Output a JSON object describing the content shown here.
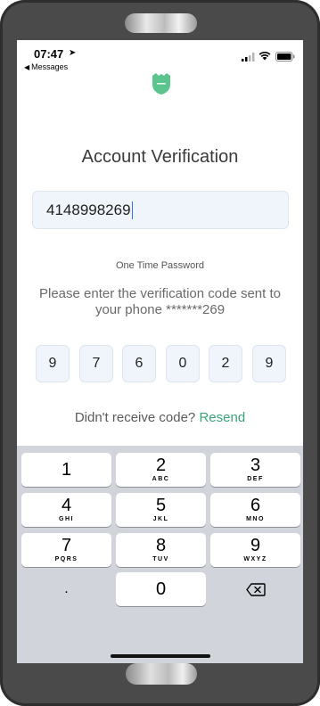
{
  "status_bar": {
    "time": "07:47",
    "back_app": "Messages"
  },
  "header": {
    "title": "Account Verification"
  },
  "phone": {
    "value": "4148998269"
  },
  "otp": {
    "label": "One Time Password",
    "instructions": "Please enter the verification code sent to your phone *******269",
    "digits": [
      "9",
      "7",
      "6",
      "0",
      "2",
      "9"
    ]
  },
  "resend": {
    "prompt": "Didn't receive code?",
    "link": "Resend"
  },
  "keyboard": {
    "keys": [
      {
        "num": "1",
        "letters": ""
      },
      {
        "num": "2",
        "letters": "ABC"
      },
      {
        "num": "3",
        "letters": "DEF"
      },
      {
        "num": "4",
        "letters": "GHI"
      },
      {
        "num": "5",
        "letters": "JKL"
      },
      {
        "num": "6",
        "letters": "MNO"
      },
      {
        "num": "7",
        "letters": "PQRS"
      },
      {
        "num": "8",
        "letters": "TUV"
      },
      {
        "num": "9",
        "letters": "WXYZ"
      },
      {
        "num": "0",
        "letters": ""
      }
    ],
    "decimal": ".",
    "delete_icon": "backspace-icon"
  },
  "colors": {
    "accent": "#3aa27a",
    "input_bg": "#f0f5fb",
    "keyboard_bg": "#d1d4db",
    "device_frame": "#4a4a4a"
  }
}
